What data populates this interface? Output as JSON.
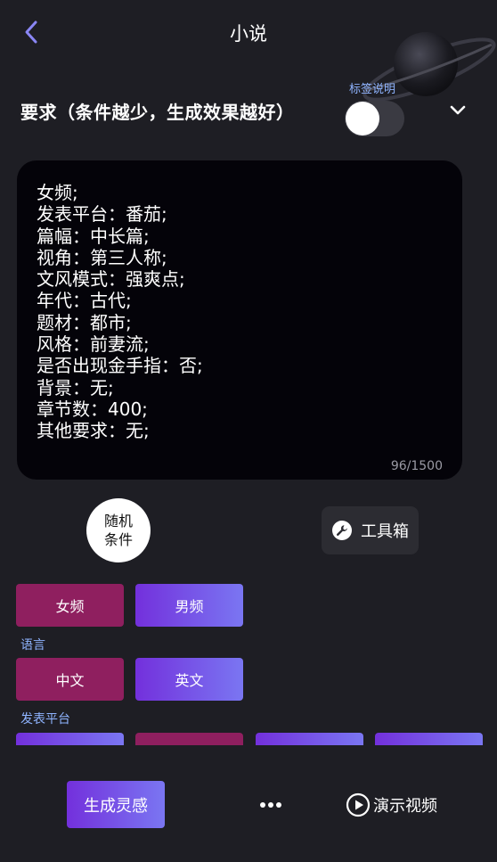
{
  "header": {
    "title": "小说",
    "back_icon": "chevron-left-icon"
  },
  "requirements": {
    "title": "要求（条件越少，生成效果越好）",
    "tag_help_label": "标签说明",
    "toggle_on": false,
    "expand_icon": "chevron-down-icon"
  },
  "editor": {
    "text": "女频;\n发表平台：番茄;\n篇幅：中长篇;\n视角：第三人称;\n文风模式：强爽点;\n年代：古代;\n题材：都市;\n风格：前妻流;\n是否出现金手指：否;\n背景：无;\n章节数：400;\n其他要求：无;",
    "char_count": "96/1500"
  },
  "actions": {
    "random_label": "随机条件",
    "toolbox_label": "工具箱",
    "toolbox_icon": "wrench-icon"
  },
  "options": {
    "gender": [
      "女频",
      "男频"
    ],
    "language_label": "语言",
    "language": [
      "中文",
      "英文"
    ],
    "platform_label": "发表平台"
  },
  "bottom": {
    "generate_label": "生成灵感",
    "more_icon": "more-dots-icon",
    "demo_label": "演示视频",
    "demo_icon": "play-circle-icon"
  },
  "colors": {
    "background": "#1e1e24",
    "selected_chip": "#8f1f5f",
    "accent_gradient_start": "#7330dc",
    "accent_gradient_end": "#7a76f2",
    "link_blue": "#8fb4ff",
    "back_arrow": "#8a86f5"
  }
}
